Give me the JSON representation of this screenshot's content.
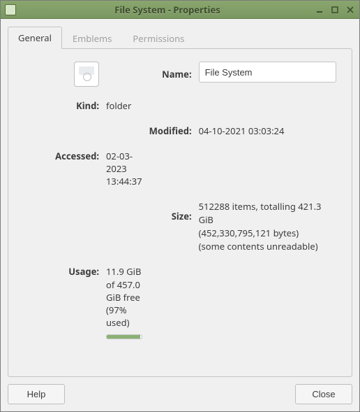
{
  "window": {
    "title": "File System - Properties"
  },
  "tabs": {
    "general": "General",
    "emblems": "Emblems",
    "permissions": "Permissions"
  },
  "labels": {
    "name": "Name:",
    "kind": "Kind:",
    "modified": "Modified:",
    "accessed": "Accessed:",
    "size": "Size:",
    "usage": "Usage:"
  },
  "values": {
    "name": "File System",
    "kind": "folder",
    "modified": "04-10-2021 03:03:24",
    "accessed": "02-03-2023 13:44:37",
    "size_line1": "512288 items, totalling 421.3 GiB",
    "size_line2": "(452,330,795,121 bytes)",
    "size_line3": "(some contents unreadable)",
    "usage_text": "11.9 GiB of 457.0 GiB free (97% used)",
    "usage_percent": "97"
  },
  "buttons": {
    "help": "Help",
    "close": "Close"
  }
}
